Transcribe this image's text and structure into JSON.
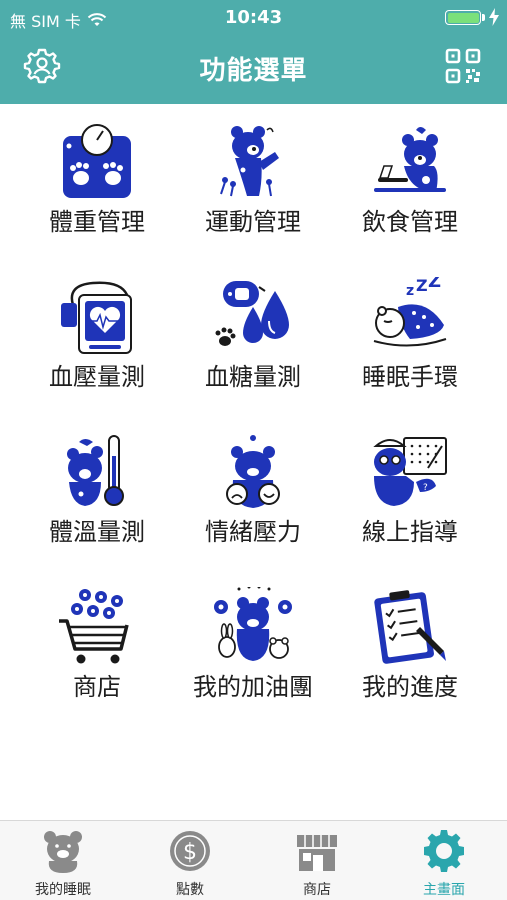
{
  "status_bar": {
    "carrier": "無 SIM 卡",
    "time": "10:43",
    "battery_level": 1.0
  },
  "nav": {
    "title": "功能選單",
    "left_icon": "user-settings-icon",
    "right_icon": "qr-code-icon"
  },
  "colors": {
    "header": "#4eadab",
    "icon_blue": "#1f34b8",
    "tab_active": "#2aa6ad",
    "tab_inactive": "#8a8a8a"
  },
  "menu": {
    "items": [
      {
        "label": "體重管理",
        "icon": "weight-scale-icon"
      },
      {
        "label": "運動管理",
        "icon": "exercise-bear-icon"
      },
      {
        "label": "飲食管理",
        "icon": "diet-bear-icon"
      },
      {
        "label": "血壓量測",
        "icon": "blood-pressure-monitor-icon"
      },
      {
        "label": "血糖量測",
        "icon": "blood-glucose-icon"
      },
      {
        "label": "睡眠手環",
        "icon": "sleep-bracelet-icon"
      },
      {
        "label": "體溫量測",
        "icon": "thermometer-bear-icon"
      },
      {
        "label": "情緒壓力",
        "icon": "emotion-bear-icon"
      },
      {
        "label": "線上指導",
        "icon": "online-coach-bear-icon"
      },
      {
        "label": "商店",
        "icon": "shopping-cart-icon"
      },
      {
        "label": "我的加油團",
        "icon": "cheer-team-icon"
      },
      {
        "label": "我的進度",
        "icon": "progress-clipboard-icon"
      }
    ]
  },
  "tabbar": {
    "tabs": [
      {
        "label": "我的睡眠",
        "icon": "bear-icon",
        "active": false
      },
      {
        "label": "點數",
        "icon": "dollar-coin-icon",
        "active": false
      },
      {
        "label": "商店",
        "icon": "storefront-icon",
        "active": false
      },
      {
        "label": "主畫面",
        "icon": "gear-icon",
        "active": true
      }
    ]
  }
}
